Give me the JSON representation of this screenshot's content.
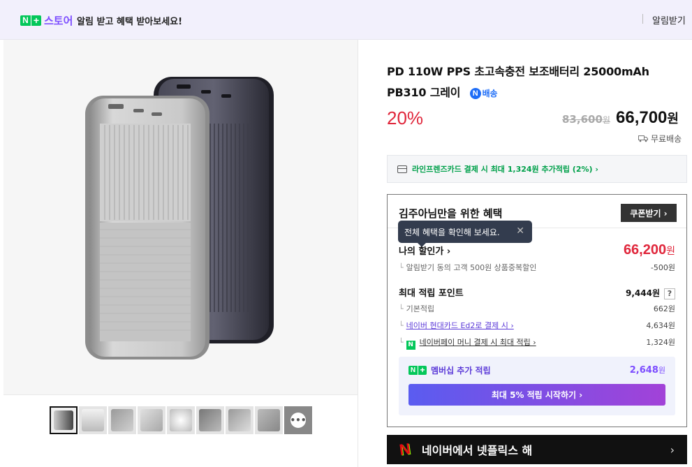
{
  "banner": {
    "brand_n": "N",
    "brand_plus": "+",
    "store": "스토어",
    "message": "알림 받고 혜택 받아보세요!",
    "alarm": "알림받기"
  },
  "gallery": {
    "thumbnails": 9,
    "chat_glyph": "•••"
  },
  "product": {
    "title": "PD 110W PPS 초고속충전 보조배터리 25000mAh PB310 그레이",
    "delivery_badge": "N",
    "delivery_label": "배송",
    "discount": "20%",
    "original_price": "83,600",
    "original_unit": "원",
    "price": "66,700",
    "price_unit": "원",
    "shipping": "무료배송"
  },
  "card_promo": {
    "text": "라인프렌즈카드 결제 시 최대 1,324원 추가적립 (2%) ›"
  },
  "benefit": {
    "header": "김주아님만을 위한 혜택",
    "coupon_button": "쿠폰받기 ›",
    "tooltip": "전체 혜택을 확인해 보세요.",
    "tooltip_close": "✕",
    "my_price_label": "나의 할인가 ›",
    "my_price": "66,200",
    "my_price_unit": "원",
    "discount_detail_label": "알림받기 동의 고객 500원 상품중복할인",
    "discount_detail_value": "-500원",
    "max_points_label": "최대 적립 포인트",
    "max_points": "9,444원",
    "help": "?",
    "basic_label": "기본적립",
    "basic_value": "662원",
    "hyundai_label": "네이버 현대카드 Ed2로 결제 시 ›",
    "hyundai_value": "4,634원",
    "npay_label": "네이버페이 머니 결제 시 최대 적립 ›",
    "npay_value": "1,324원",
    "member_label": "멤버십 추가 적립",
    "member_value": "2,648",
    "member_unit": "원",
    "member_button": "최대 5% 적립 시작하기 ›"
  },
  "netflix": {
    "logo": "N",
    "text": "네이버에서 넷플릭스 해",
    "chevron": "›"
  },
  "colors": {
    "accent_purple": "#7c4dff",
    "sale_red": "#e0263b",
    "naver_green": "#03c75a",
    "delivery_blue": "#1e6df7"
  }
}
